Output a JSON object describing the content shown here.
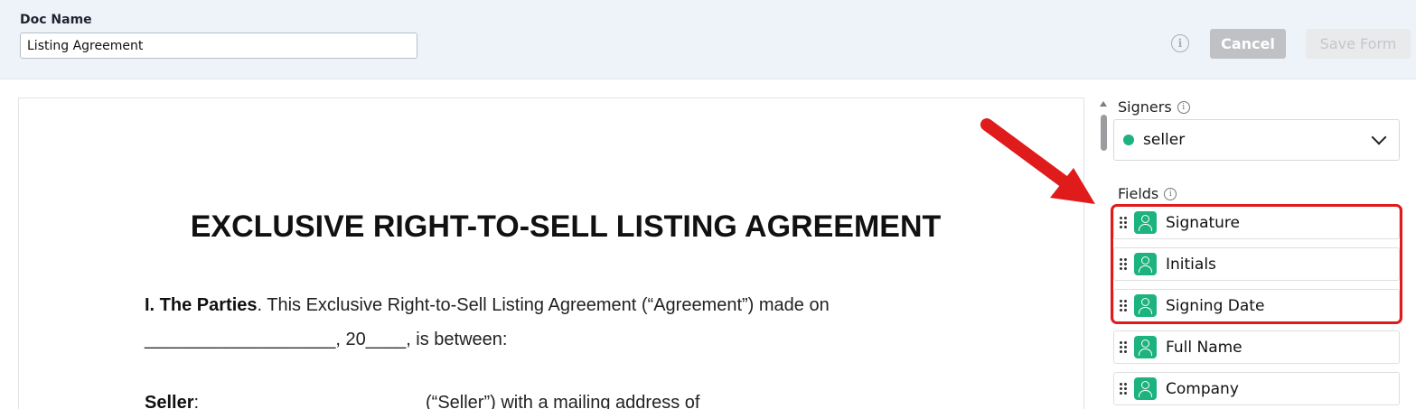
{
  "header": {
    "doc_name_label": "Doc Name",
    "doc_name_value": "Listing Agreement",
    "info_icon": "info-icon",
    "cancel_label": "Cancel",
    "save_label": "Save Form"
  },
  "document": {
    "title": "EXCLUSIVE RIGHT-TO-SELL LISTING AGREEMENT",
    "line1_bold": "I. The Parties",
    "line1_rest": ". This Exclusive Right-to-Sell Listing Agreement (“Agreement”) made on",
    "line2": "___________________, 20____, is between:",
    "line3_bold": "Seller",
    "line3_colon": ":",
    "line3_rest": "(“Seller”) with a mailing address of"
  },
  "sidebar": {
    "signers_label": "Signers",
    "selected_signer": "seller",
    "signer_color": "#1db37e",
    "fields_label": "Fields",
    "fields": [
      {
        "label": "Signature",
        "icon": "person-icon"
      },
      {
        "label": "Initials",
        "icon": "person-icon"
      },
      {
        "label": "Signing Date",
        "icon": "person-icon"
      },
      {
        "label": "Full Name",
        "icon": "person-icon"
      },
      {
        "label": "Company",
        "icon": "person-icon"
      }
    ]
  },
  "annotation": {
    "highlight_color": "#e01b1b"
  }
}
